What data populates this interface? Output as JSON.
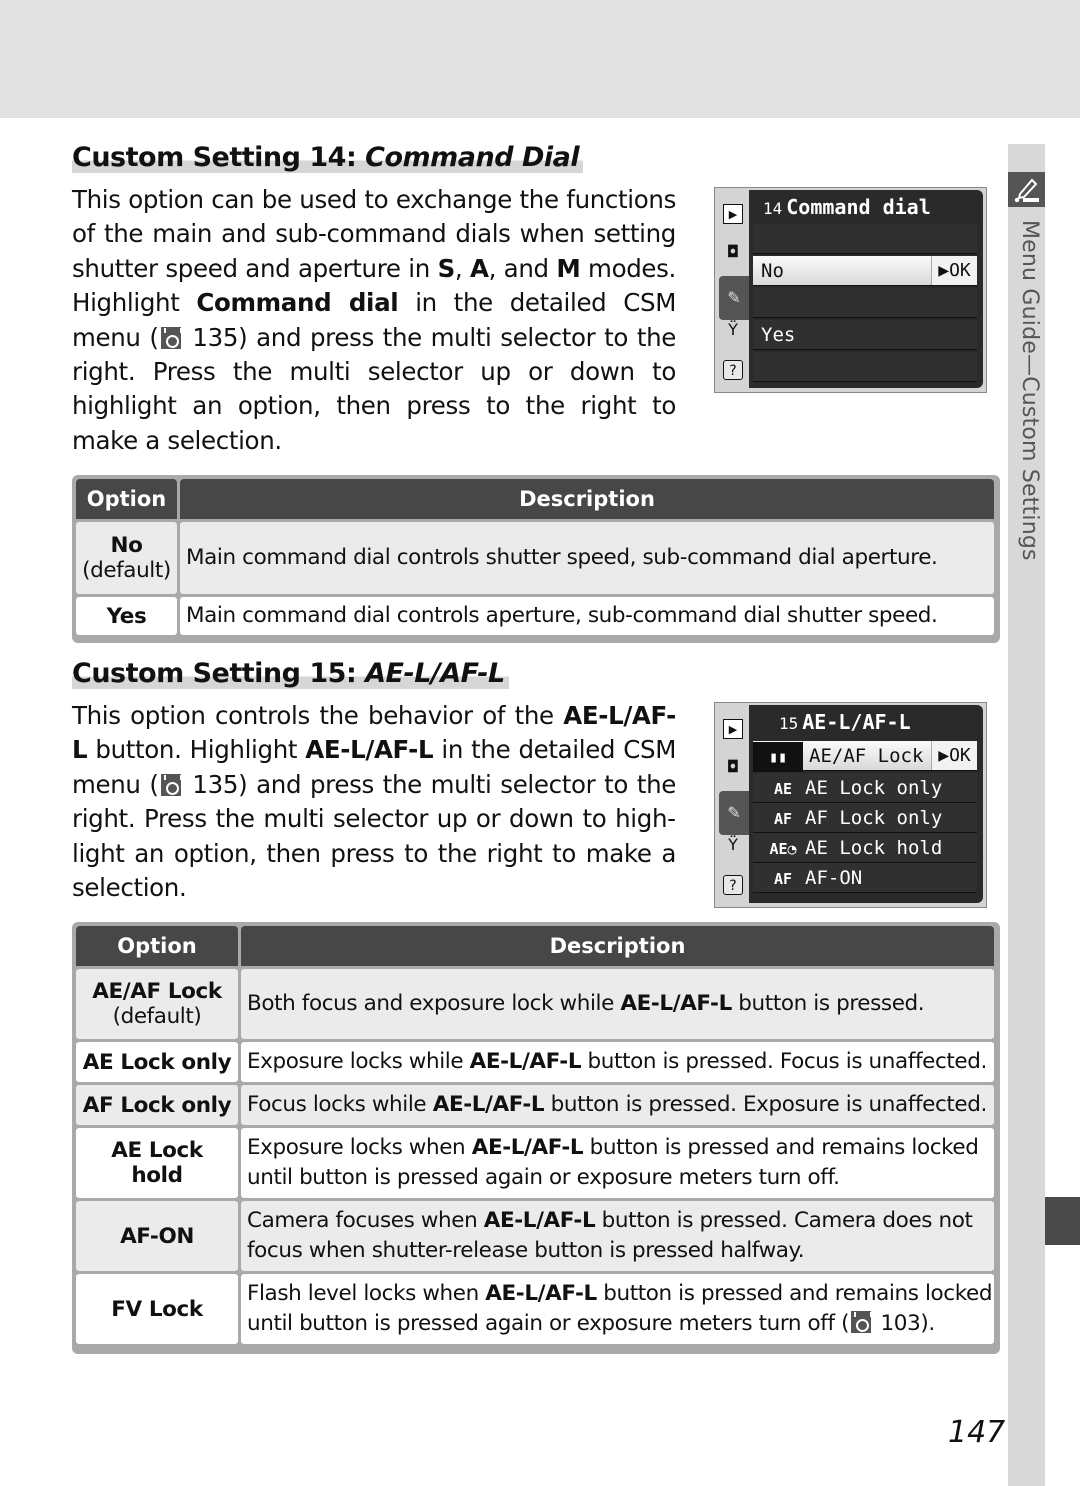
{
  "sidebar": {
    "label": "Menu Guide—Custom Settings",
    "icon": "pencil-custom-settings-icon"
  },
  "section14": {
    "heading_prefix": "Custom Setting 14: ",
    "heading_italic": "Command Dial",
    "paragraph": [
      {
        "t": "This option can be used to exchange the func­tions of the main and sub-command dials when setting shutter speed and aperture in "
      },
      {
        "b": "S"
      },
      {
        "t": ", "
      },
      {
        "b": "A"
      },
      {
        "t": ", and "
      },
      {
        "b": "M"
      },
      {
        "t": " modes.  Highlight "
      },
      {
        "b": "Command dial"
      },
      {
        "t": " in the detailed CSM menu ("
      },
      {
        "icon": "reference-page-icon"
      },
      {
        "t": " 135) and press the multi selector to the right.  Press the multi selector up or down to highlight an option, then press to the right to make a selection."
      }
    ],
    "camera_screen": {
      "number": "14",
      "title": "Command dial",
      "tabs": [
        "playback-icon",
        "shooting-icon",
        "custom-settings-icon",
        "setup-icon",
        "help-icon"
      ],
      "rows": [
        {
          "label": "",
          "selected": false
        },
        {
          "label": "No",
          "selected": true,
          "confirm": "▶OK"
        },
        {
          "label": "",
          "selected": false
        },
        {
          "label": "Yes",
          "selected": false
        },
        {
          "label": "",
          "selected": false
        }
      ]
    },
    "table": {
      "headers": [
        "Option",
        "Description"
      ],
      "rows": [
        {
          "option": "No",
          "note": "(default)",
          "description": [
            {
              "t": "Main command dial controls shutter speed, sub-command dial aperture."
            }
          ]
        },
        {
          "option": "Yes",
          "note": "",
          "description": [
            {
              "t": "Main command dial controls aperture, sub-command dial shutter speed."
            }
          ]
        }
      ]
    }
  },
  "section15": {
    "heading_prefix": "Custom Setting 15: ",
    "heading_italic": "AE-L/AF-L",
    "paragraph": [
      {
        "t": "This option controls the behavior of the "
      },
      {
        "b": "AE-L/AF-L"
      },
      {
        "t": " button.  Highlight "
      },
      {
        "b": "AE-L/AF-L"
      },
      {
        "t": " in the detailed CSM menu ("
      },
      {
        "icon": "reference-page-icon"
      },
      {
        "t": " 135) and press the multi selector to the right.  Press the multi selector up or down to high­light an option, then press to the right to make a selection."
      }
    ],
    "camera_screen": {
      "number": "15",
      "title": "AE-L/AF-L",
      "tabs": [
        "playback-icon",
        "shooting-icon",
        "custom-settings-icon",
        "setup-icon",
        "help-icon"
      ],
      "rows": [
        {
          "icon": "▮▮",
          "label": "AE/AF Lock",
          "selected": true,
          "confirm": "▶OK"
        },
        {
          "icon": "AE",
          "label": "AE Lock only",
          "selected": false
        },
        {
          "icon": "AF",
          "label": "AF Lock only",
          "selected": false
        },
        {
          "icon": "AE◔",
          "label": "AE Lock hold",
          "selected": false
        },
        {
          "icon": "AF",
          "label": "AF-ON",
          "selected": false
        }
      ]
    },
    "table": {
      "headers": [
        "Option",
        "Description"
      ],
      "rows": [
        {
          "option": "AE/AF Lock",
          "note": "(default)",
          "description": [
            {
              "t": "Both focus and exposure lock while "
            },
            {
              "b": "AE-L/AF-L"
            },
            {
              "t": " button is pressed."
            }
          ]
        },
        {
          "option": "AE Lock only",
          "note": "",
          "description": [
            {
              "t": "Exposure locks while "
            },
            {
              "b": "AE-L/AF-L"
            },
            {
              "t": " button is pressed.  Focus is unaffected."
            }
          ]
        },
        {
          "option": "AF Lock only",
          "note": "",
          "description": [
            {
              "t": "Focus locks while "
            },
            {
              "b": "AE-L/AF-L"
            },
            {
              "t": " button is pressed.  Exposure is unaffected."
            }
          ]
        },
        {
          "option": "AE Lock hold",
          "note": "",
          "description": [
            {
              "t": "Exposure locks when "
            },
            {
              "b": "AE-L/AF-L"
            },
            {
              "t": " button is pressed and remains locked until button is pressed again or exposure meters turn off."
            }
          ]
        },
        {
          "option": "AF-ON",
          "note": "",
          "description": [
            {
              "t": "Camera focuses when "
            },
            {
              "b": "AE-L/AF-L"
            },
            {
              "t": " button is pressed.  Camera does not focus when shutter-release button is pressed halfway."
            }
          ]
        },
        {
          "option": "FV Lock",
          "note": "",
          "description": [
            {
              "t": "Flash level locks when "
            },
            {
              "b": "AE-L/AF-L"
            },
            {
              "t": " button is pressed and remains locked until button is pressed again or exposure meters turn off ("
            },
            {
              "icon": "reference-page-icon"
            },
            {
              "t": " 103)."
            }
          ]
        }
      ]
    }
  },
  "page_number": "147"
}
